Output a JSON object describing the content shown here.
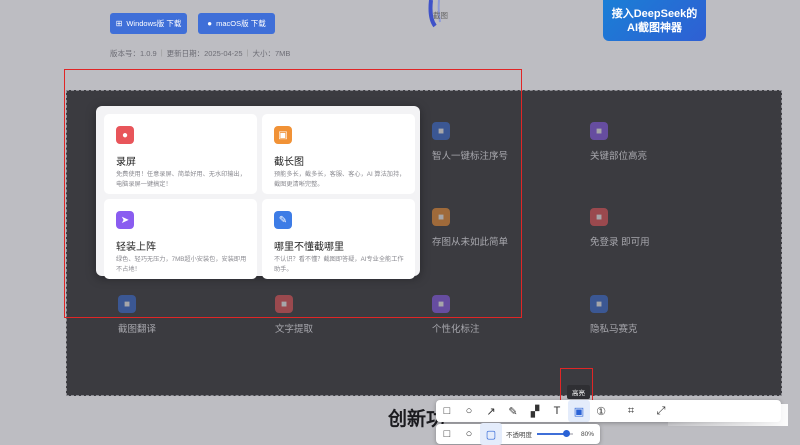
{
  "header": {
    "windows_download": "Windows版 下载",
    "macos_download": "macOS版 下载",
    "version_label": "版本号：1.0.9",
    "update_label": "更新日期：2025-04-25",
    "size_label": "大小：7MB",
    "hero_small": "截图",
    "promo_line1": "接入DeepSeek的",
    "promo_line2": "AI截图神器"
  },
  "popup_cards": [
    {
      "title": "录屏",
      "desc": "免费使用！任意录屏、简单好用、无水印输出，电脑录屏一键搞定！",
      "icon": "record-icon",
      "color": "#e8555a"
    },
    {
      "title": "截长图",
      "desc": "预能多长，截多长，客服、客心，AI 算法加持，截图更清晰完整。",
      "icon": "long-screenshot-icon",
      "color": "#f19236"
    },
    {
      "title": "轻装上阵",
      "desc": "绿色、轻巧无压力，7MB超小安装包，安装即用不占地！",
      "icon": "paper-plane-icon",
      "color": "#8a5cf0"
    },
    {
      "title": "哪里不懂截哪里",
      "desc": "不认识？看不懂？截图即答疑，AI专业全能工作助手。",
      "icon": "ask-icon",
      "color": "#3d7ce6"
    }
  ],
  "background_cards": [
    {
      "title": "智人一键标注序号",
      "desc": "",
      "icon": "list-icon",
      "color": "#3b6fd8"
    },
    {
      "title": "关键部位高亮",
      "desc": "",
      "icon": "bulb-icon",
      "color": "#8a5cf0"
    },
    {
      "title": "存图从未如此简单",
      "desc": "",
      "icon": "scissors-icon",
      "color": "#f19236"
    },
    {
      "title": "免登录 即可用",
      "desc": "",
      "icon": "check-icon",
      "color": "#e8555a"
    },
    {
      "title": "截图翻译",
      "desc": "",
      "icon": "translate-icon",
      "color": "#3b6fd8"
    },
    {
      "title": "文字提取",
      "desc": "",
      "icon": "text-extract-icon",
      "color": "#e8555a"
    },
    {
      "title": "个性化标注",
      "desc": "",
      "icon": "frame-icon",
      "color": "#8a5cf0"
    },
    {
      "title": "隐私马赛克",
      "desc": "",
      "icon": "mosaic-icon",
      "color": "#3b6fd8"
    }
  ],
  "bottom_title": "创新功",
  "tooltip": "高亮",
  "toolbar_secondary": {
    "opacity_label": "不透明度",
    "opacity_value": "80%",
    "opacity_fraction": 0.8
  },
  "colors": {
    "accent": "#3f6fd8",
    "annotation_red": "#e02626",
    "overlay": "#3b3b40"
  }
}
